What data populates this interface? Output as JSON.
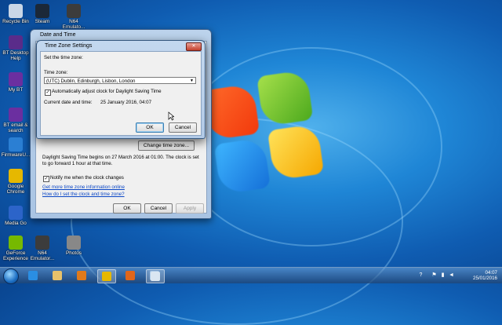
{
  "desktop_icons": [
    {
      "label": "Recycle Bin",
      "icon": "recycle-bin-icon",
      "color": "#c9d6e6"
    },
    {
      "label": "Steam",
      "icon": "steam-icon",
      "color": "#1b2838"
    },
    {
      "label": "N64\nEmulato...",
      "icon": "n64-emulator-icon",
      "color": "#3c3c3c"
    },
    {
      "label": "BT Desktop\nHelp",
      "icon": "help-icon",
      "color": "#5a2c8a"
    },
    {
      "label": "My BT",
      "icon": "bt-icon",
      "color": "#6b2fa0"
    },
    {
      "label": "BT email &\nsearch",
      "icon": "bt-email-icon",
      "color": "#6b2fa0"
    },
    {
      "label": "FirmwareU...",
      "icon": "firmware-icon",
      "color": "#2b7fd3"
    },
    {
      "label": "Google\nChrome",
      "icon": "chrome-icon",
      "color": "#e6b800"
    },
    {
      "label": "Media Go",
      "icon": "media-go-icon",
      "color": "#2c64c9"
    },
    {
      "label": "GeForce\nExperience",
      "icon": "geforce-icon",
      "color": "#76b900"
    },
    {
      "label": "N64\nEmulator...",
      "icon": "n64-emulator-icon",
      "color": "#3c3c3c"
    },
    {
      "label": "Photos",
      "icon": "photos-icon",
      "color": "#888888"
    }
  ],
  "outer_dialog": {
    "title": "Date and Time",
    "change_tz_button": "Change time zone...",
    "dst_text": "Daylight Saving Time begins on 27 March 2016 at 01:00. The clock is set to go forward 1 hour at that time.",
    "notify_label": "Notify me when the clock changes",
    "notify_checked": "✓",
    "link1": "Get more time zone information online",
    "link2": "How do I set the clock and time zone?",
    "ok": "OK",
    "cancel": "Cancel",
    "apply": "Apply"
  },
  "inner_dialog": {
    "title": "Time Zone Settings",
    "close": "✕",
    "set_label": "Set the time zone:",
    "tz_label": "Time zone:",
    "tz_value": "(UTC) Dublin, Edinburgh, Lisbon, London",
    "dropdown_arrow": "▼",
    "auto_dst_label": "Automatically adjust clock for Daylight Saving Time",
    "auto_dst_checked": "✓",
    "current_label": "Current date and time:",
    "current_value": "25 January 2016, 04:07",
    "ok": "OK",
    "cancel": "Cancel"
  },
  "taskbar": {
    "apps": [
      {
        "icon": "internet-explorer-icon",
        "color": "#2a8ee3",
        "active": false
      },
      {
        "icon": "file-explorer-icon",
        "color": "#e8c26a",
        "active": false
      },
      {
        "icon": "media-player-icon",
        "color": "#e07a1b",
        "active": false
      },
      {
        "icon": "chrome-icon",
        "color": "#e6b800",
        "active": true
      },
      {
        "icon": "firefox-icon",
        "color": "#e0661b",
        "active": false
      },
      {
        "icon": "paint-icon",
        "color": "#8fb9e0",
        "active": false
      },
      {
        "icon": "date-time-icon",
        "color": "#d9e6f2",
        "active": true
      }
    ],
    "time": "04:07",
    "date": "25/01/2016",
    "help": "?"
  },
  "colors": {
    "accent": "#0a46c6"
  }
}
